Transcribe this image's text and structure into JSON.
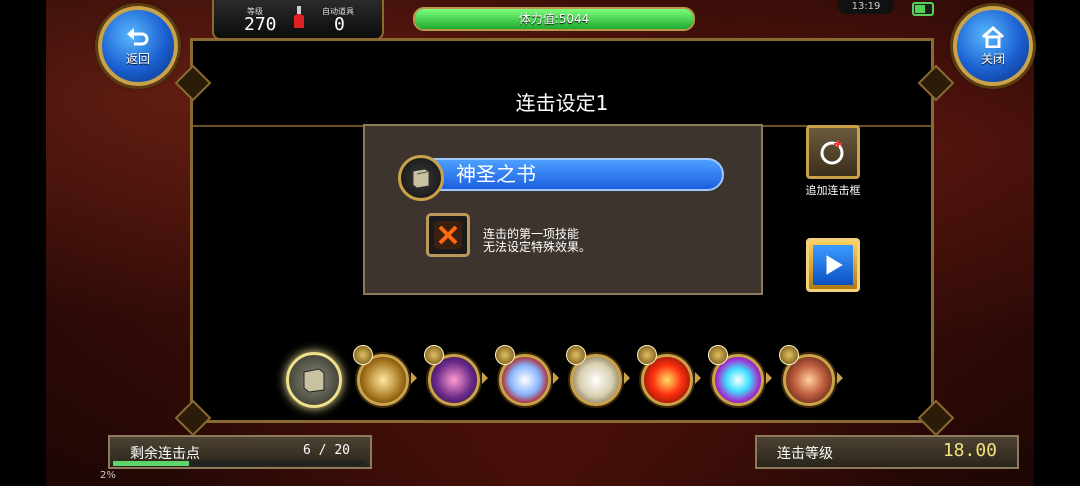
{
  "top": {
    "back_label": "返回",
    "close_label": "关闭",
    "level_label": "等级",
    "level_value": "270",
    "auto_item_label": "自动道具",
    "auto_item_value": "0",
    "stamina_text": "体力值:5044",
    "stamina_fill": 1.0,
    "time": "13:19"
  },
  "panel": {
    "title": "连击设定1",
    "selected_skill": "神圣之书",
    "note_line1": "连击的第一项技能",
    "note_line2": "无法设定特殊效果。",
    "add_frame_label": "追加连击框"
  },
  "skills": [
    {
      "icon": "holy-book-icon"
    },
    {
      "icon": "light-sword-icon"
    },
    {
      "icon": "summon-icon"
    },
    {
      "icon": "spear-strike-icon"
    },
    {
      "icon": "horn-blast-icon"
    },
    {
      "icon": "flame-slash-icon"
    },
    {
      "icon": "lightning-burst-icon"
    },
    {
      "icon": "ring-aura-icon"
    }
  ],
  "bottom": {
    "remain_label": "剩余连击点",
    "remain_value": "6 / 20",
    "remain_progress": 0.3,
    "combo_level_label": "连击等级",
    "combo_level_value": "18.00",
    "mini_value": "2%"
  },
  "colors": {
    "accent_gold": "#c9a24a",
    "blue": "#1b5fe0",
    "combo_value": "#f3e07a"
  }
}
